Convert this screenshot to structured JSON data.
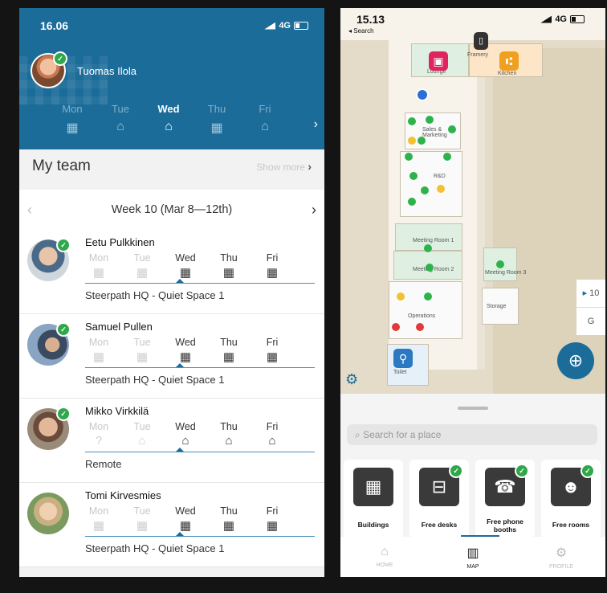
{
  "left": {
    "time": "16.06",
    "network": "4G",
    "user_name": "Tuomas Ilola",
    "header_days": [
      {
        "label": "Mon",
        "icon": "building-icon",
        "glyph": "▦"
      },
      {
        "label": "Tue",
        "icon": "home-icon",
        "glyph": "⌂"
      },
      {
        "label": "Wed",
        "icon": "home-icon",
        "glyph": "⌂"
      },
      {
        "label": "Thu",
        "icon": "building-icon",
        "glyph": "▦"
      },
      {
        "label": "Fri",
        "icon": "home-icon",
        "glyph": "⌂"
      }
    ],
    "team_title": "My team",
    "show_more": "Show more",
    "week_label": "Week 10 (Mar 8—12th)",
    "members": [
      {
        "name": "Eetu Pulkkinen",
        "location": "Steerpath HQ - Quiet Space 1",
        "days": [
          {
            "label": "Mon",
            "glyph": "▦"
          },
          {
            "label": "Tue",
            "glyph": "▦"
          },
          {
            "label": "Wed",
            "glyph": "▦"
          },
          {
            "label": "Thu",
            "glyph": "▦"
          },
          {
            "label": "Fri",
            "glyph": "▦"
          }
        ]
      },
      {
        "name": "Samuel Pullen",
        "location": "Steerpath HQ - Quiet Space 1",
        "days": [
          {
            "label": "Mon",
            "glyph": "▦"
          },
          {
            "label": "Tue",
            "glyph": "▦"
          },
          {
            "label": "Wed",
            "glyph": "▦"
          },
          {
            "label": "Thu",
            "glyph": "▦"
          },
          {
            "label": "Fri",
            "glyph": "▦"
          }
        ]
      },
      {
        "name": "Mikko Virkkilä",
        "location": "Remote",
        "days": [
          {
            "label": "Mon",
            "glyph": "?"
          },
          {
            "label": "Tue",
            "glyph": "⌂"
          },
          {
            "label": "Wed",
            "glyph": "⌂"
          },
          {
            "label": "Thu",
            "glyph": "⌂"
          },
          {
            "label": "Fri",
            "glyph": "⌂"
          }
        ]
      },
      {
        "name": "Tomi Kirvesmies",
        "location": "Steerpath HQ - Quiet Space 1",
        "days": [
          {
            "label": "Mon",
            "glyph": "▦"
          },
          {
            "label": "Tue",
            "glyph": "▦"
          },
          {
            "label": "Wed",
            "glyph": "▦"
          },
          {
            "label": "Thu",
            "glyph": "▦"
          },
          {
            "label": "Fri",
            "glyph": "▦"
          }
        ]
      }
    ]
  },
  "right": {
    "time": "15.13",
    "back": "◂ Search",
    "network": "4G",
    "map_labels": {
      "framery": "Framery",
      "kitchen": "Kitchen",
      "lounge": "Lounge",
      "sales": "Sales & Marketing",
      "rd": "R&D",
      "meeting1": "Meeting Room 1",
      "meeting2": "Meeting Room 2",
      "meeting3": "Meeting Room 3",
      "operations": "Operations",
      "storage": "Storage",
      "toilet": "Toilet"
    },
    "floors": [
      "10",
      "G"
    ],
    "search_placeholder": "Search for a place",
    "categories": [
      "Buildings",
      "Free desks",
      "Free phone booths",
      "Free rooms"
    ],
    "tabs": [
      "HOME",
      "MAP",
      "PROFILE"
    ]
  },
  "colors": {
    "brand": "#1b6c99",
    "available": "#2eb34c",
    "busy": "#e03b3b",
    "partial": "#f1c232"
  }
}
